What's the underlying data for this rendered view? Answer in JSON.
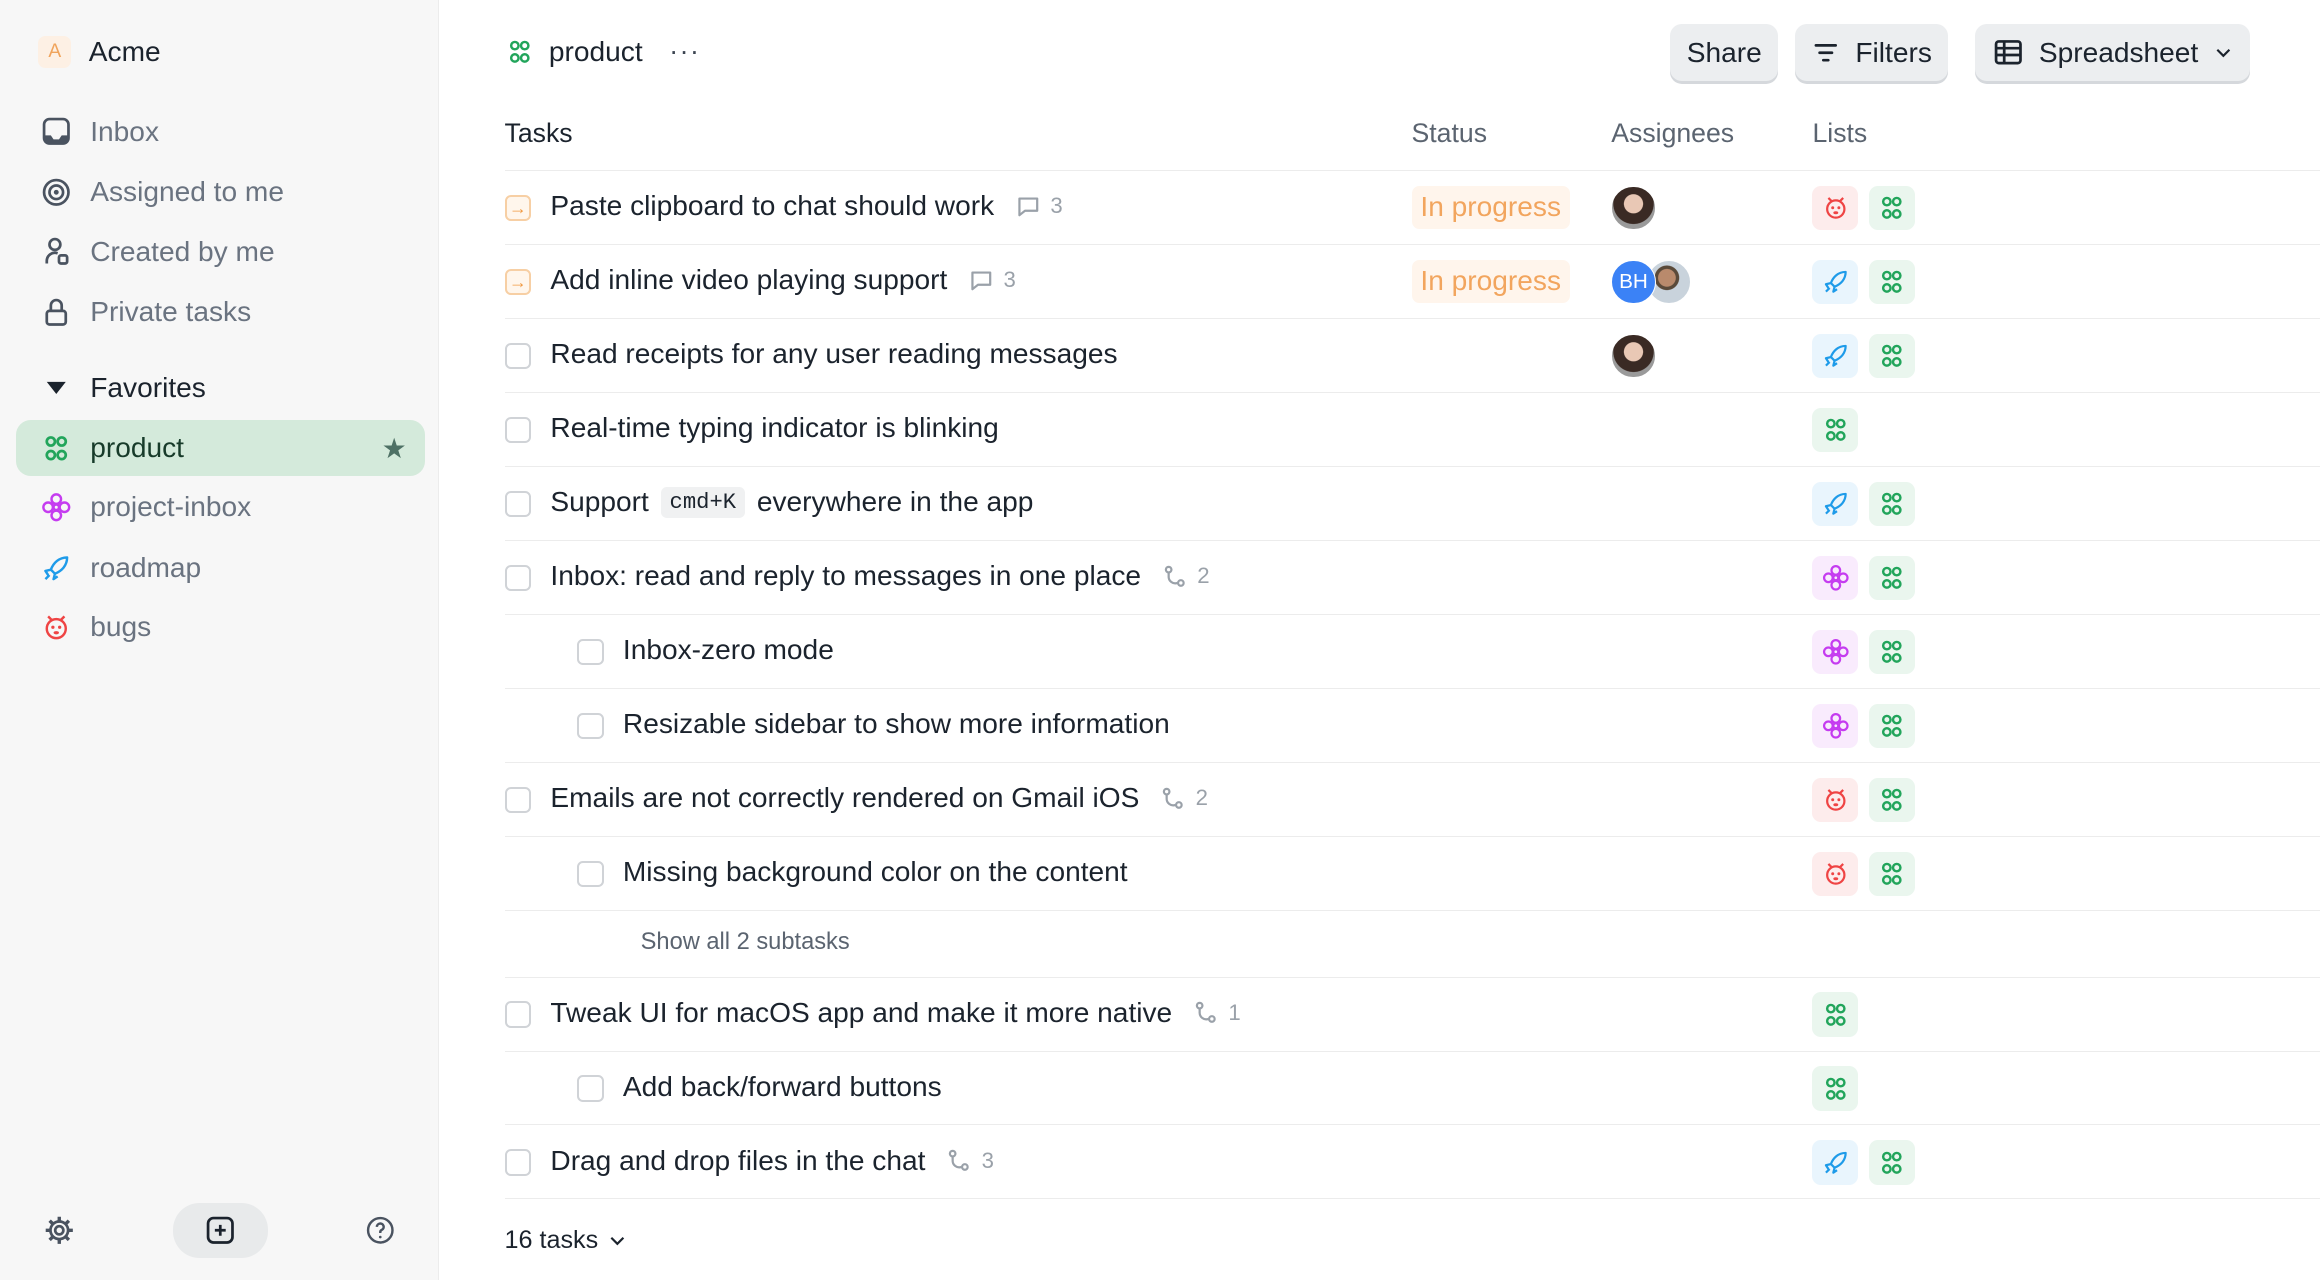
{
  "workspace": {
    "initial": "A",
    "name": "Acme"
  },
  "sidebar": {
    "nav": [
      {
        "label": "Inbox",
        "icon": "inbox-icon"
      },
      {
        "label": "Assigned to me",
        "icon": "target-icon"
      },
      {
        "label": "Created by me",
        "icon": "user-icon"
      },
      {
        "label": "Private tasks",
        "icon": "lock-icon"
      }
    ],
    "favorites_label": "Favorites",
    "favorites": [
      {
        "label": "product",
        "icon": "product-icon",
        "active": true,
        "starred": true
      },
      {
        "label": "project-inbox",
        "icon": "flower-icon"
      },
      {
        "label": "roadmap",
        "icon": "rocket-icon"
      },
      {
        "label": "bugs",
        "icon": "bug-icon"
      }
    ]
  },
  "header": {
    "title": "product",
    "more": "···",
    "share": "Share",
    "filters": "Filters",
    "view": "Spreadsheet"
  },
  "columns": {
    "tasks": "Tasks",
    "status": "Status",
    "assignees": "Assignees",
    "lists": "Lists"
  },
  "colors": {
    "accent_green": "#22a55b",
    "in_progress": "#f2a55e",
    "bug_red": "#ef4444",
    "rocket_blue": "#1e9be9",
    "flower_purple": "#c53cf0",
    "avatar_blue": "#3b82f6"
  },
  "rows": [
    {
      "title": "Paste clipboard to chat should work",
      "state": "in_progress",
      "meta": {
        "icon": "comment-icon",
        "count": "3"
      },
      "status": "In progress",
      "assignees": [
        "photo-woman"
      ],
      "lists": [
        "bug",
        "product"
      ]
    },
    {
      "title": "Add inline video playing support",
      "state": "in_progress",
      "meta": {
        "icon": "comment-icon",
        "count": "3"
      },
      "status": "In progress",
      "assignees": [
        "BH",
        "photo-man"
      ],
      "lists": [
        "rocket",
        "product"
      ]
    },
    {
      "title": "Read receipts for any user reading messages",
      "assignees": [
        "photo-woman"
      ],
      "lists": [
        "rocket",
        "product"
      ]
    },
    {
      "title": "Real-time typing indicator is blinking",
      "lists": [
        "product"
      ]
    },
    {
      "title_parts": [
        "Support",
        "cmd+K",
        "everywhere in the app"
      ],
      "lists": [
        "rocket",
        "product"
      ]
    },
    {
      "title": "Inbox: read and reply to messages in one place",
      "meta": {
        "icon": "subtask-icon",
        "count": "2"
      },
      "lists": [
        "flower",
        "product"
      ]
    },
    {
      "title": "Inbox-zero mode",
      "sub": true,
      "lists": [
        "flower",
        "product"
      ]
    },
    {
      "title": "Resizable sidebar to show more information",
      "sub": true,
      "lists": [
        "flower",
        "product"
      ]
    },
    {
      "title": "Emails are not correctly rendered on Gmail iOS",
      "meta": {
        "icon": "subtask-icon",
        "count": "2"
      },
      "lists": [
        "bug",
        "product"
      ]
    },
    {
      "title": "Missing background color on the content",
      "sub": true,
      "lists": [
        "bug",
        "product"
      ]
    },
    {
      "show_all": "Show all 2 subtasks"
    },
    {
      "title": "Tweak UI for macOS app and make it more native",
      "meta": {
        "icon": "subtask-icon",
        "count": "1"
      },
      "lists": [
        "product"
      ]
    },
    {
      "title": "Add back/forward buttons",
      "sub": true,
      "lists": [
        "product"
      ]
    },
    {
      "title": "Drag and drop files in the chat",
      "meta": {
        "icon": "subtask-icon",
        "count": "3"
      },
      "lists": [
        "rocket",
        "product"
      ]
    }
  ],
  "footer": {
    "count": "16 tasks"
  }
}
